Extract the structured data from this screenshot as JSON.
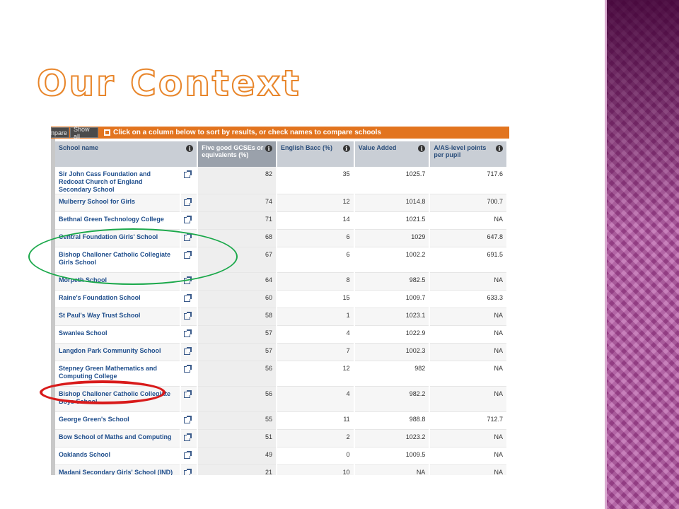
{
  "slide": {
    "title": "Our Context"
  },
  "toolbar": {
    "compare_label": "mpare",
    "show_all_label": "Show all",
    "message": "Click on a column below to sort by results, or check names to compare schools"
  },
  "table": {
    "headers": {
      "name": "School name",
      "gcse": "Five good GCSEs or equivalents (%)",
      "ebacc": "English Bacc (%)",
      "value_added": "Value Added",
      "alevel": "A/AS-level points per pupil"
    },
    "rows": [
      {
        "name": "Sir John Cass Foundation and Redcoat Church of England Secondary School",
        "gcse": "82",
        "ebacc": "35",
        "va": "1025.7",
        "al": "717.6"
      },
      {
        "name": "Mulberry School for Girls",
        "gcse": "74",
        "ebacc": "12",
        "va": "1014.8",
        "al": "700.7"
      },
      {
        "name": "Bethnal Green Technology College",
        "gcse": "71",
        "ebacc": "14",
        "va": "1021.5",
        "al": "NA"
      },
      {
        "name": "Central Foundation Girls' School",
        "gcse": "68",
        "ebacc": "6",
        "va": "1029",
        "al": "647.8"
      },
      {
        "name": "Bishop Challoner Catholic Collegiate Girls School",
        "gcse": "67",
        "ebacc": "6",
        "va": "1002.2",
        "al": "691.5"
      },
      {
        "name": "Morpeth School",
        "gcse": "64",
        "ebacc": "8",
        "va": "982.5",
        "al": "NA"
      },
      {
        "name": "Raine's Foundation School",
        "gcse": "60",
        "ebacc": "15",
        "va": "1009.7",
        "al": "633.3"
      },
      {
        "name": "St Paul's Way Trust School",
        "gcse": "58",
        "ebacc": "1",
        "va": "1023.1",
        "al": "NA"
      },
      {
        "name": "Swanlea School",
        "gcse": "57",
        "ebacc": "4",
        "va": "1022.9",
        "al": "NA"
      },
      {
        "name": "Langdon Park Community School",
        "gcse": "57",
        "ebacc": "7",
        "va": "1002.3",
        "al": "NA"
      },
      {
        "name": "Stepney Green Mathematics and Computing College",
        "gcse": "56",
        "ebacc": "12",
        "va": "982",
        "al": "NA"
      },
      {
        "name": "Bishop Challoner Catholic Collegiate Boys School",
        "gcse": "56",
        "ebacc": "4",
        "va": "982.2",
        "al": "NA"
      },
      {
        "name": "George Green's School",
        "gcse": "55",
        "ebacc": "11",
        "va": "988.8",
        "al": "712.7"
      },
      {
        "name": "Bow School of Maths and Computing",
        "gcse": "51",
        "ebacc": "2",
        "va": "1023.2",
        "al": "NA"
      },
      {
        "name": "Oaklands School",
        "gcse": "49",
        "ebacc": "0",
        "va": "1009.5",
        "al": "NA"
      },
      {
        "name": "Madani Secondary Girls' School (IND)",
        "gcse": "21",
        "ebacc": "10",
        "va": "NA",
        "al": "NA"
      }
    ]
  },
  "colors": {
    "title_outline": "#e8852a",
    "toolbar": "#e2741f",
    "link_text": "#1f4e8c",
    "green_annotation": "#1aa84a",
    "red_annotation": "#d81a1a",
    "side_panel": "#b04a9e"
  }
}
